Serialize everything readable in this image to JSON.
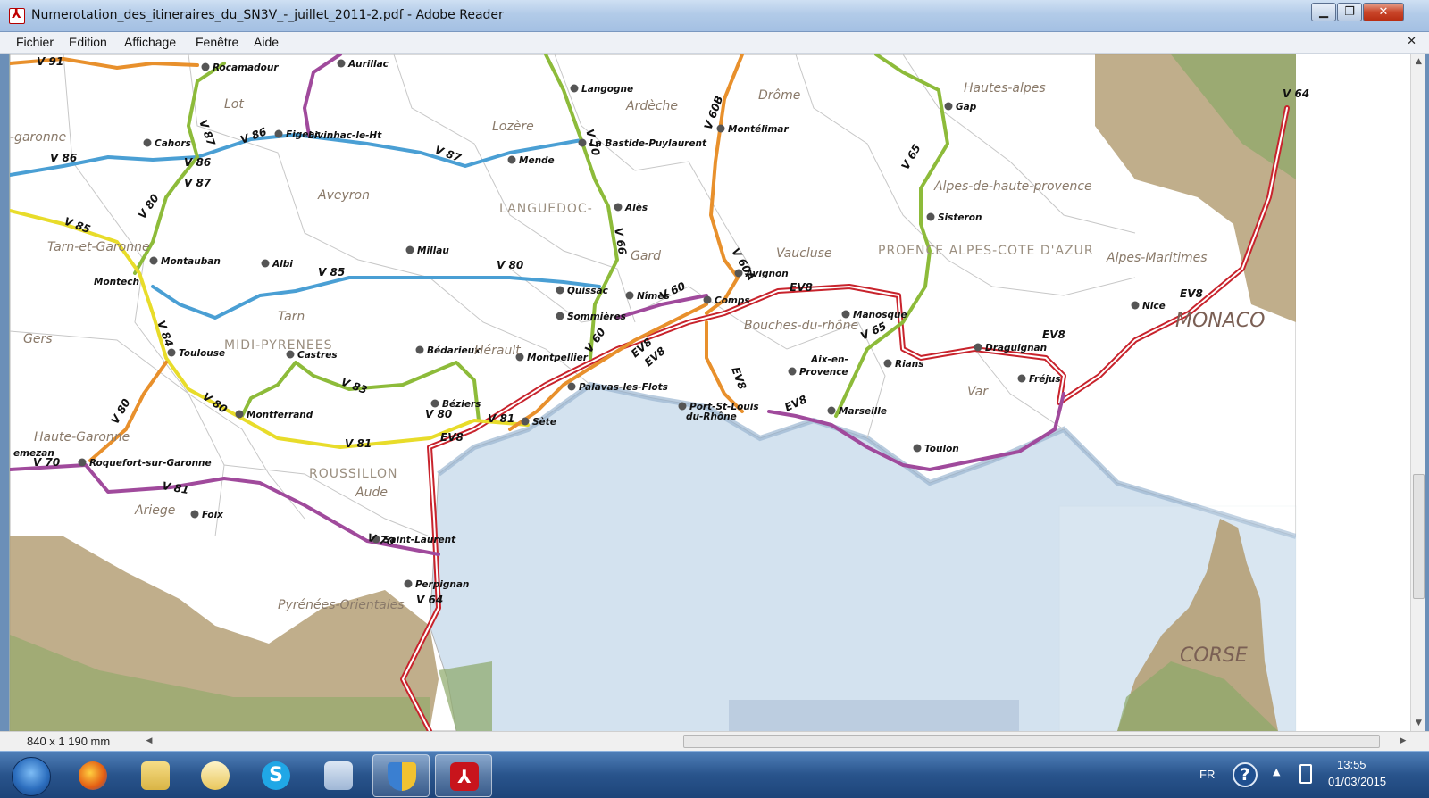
{
  "window": {
    "title": "Numerotation_des_itineraires_du_SN3V_-_juillet_2011-2.pdf - Adobe Reader"
  },
  "menu": [
    "Fichier",
    "Edition",
    "Affichage",
    "Fenêtre",
    "Aide"
  ],
  "status": {
    "page_size": "840 x 1 190 mm"
  },
  "taskbar": {
    "lang": "FR",
    "time": "13:55",
    "date": "01/03/2015"
  },
  "icons": {
    "app": "adobe-reader-icon",
    "start": "windows-start-icon",
    "firefox": "firefox-icon",
    "explorer": "folder-icon",
    "outlook": "mail-icon",
    "skype": "skype-icon",
    "photos": "photo-viewer-icon",
    "shield": "security-shield-icon",
    "reader": "adobe-reader-icon"
  },
  "map": {
    "colors": {
      "sea": "#d3e2ef",
      "land": "#ffffff",
      "relief": "#b5a077",
      "v_blue": "#4a9fd4",
      "v_green": "#8dbb3a",
      "v_orange": "#e8902c",
      "v_yellow": "#e8dc2a",
      "v_purple": "#a04a9c",
      "ev8": "#c8232c"
    },
    "route_labels": [
      "V 91",
      "V 87",
      "V 86",
      "V 86",
      "V 86",
      "V 87",
      "V 87",
      "V 80",
      "V 85",
      "V 85",
      "V 80",
      "V 84",
      "V 83",
      "V 80",
      "V 80",
      "V 80",
      "V 81",
      "V 81",
      "V 81",
      "V 70",
      "V 70",
      "V 70",
      "V 66",
      "V 60",
      "V 60",
      "V 60B",
      "V 60A",
      "EV8",
      "EV8",
      "EV8",
      "EV8",
      "EV8",
      "EV8",
      "EV8",
      "V 64",
      "V 64",
      "V 65",
      "V 65",
      "EV8"
    ],
    "cities": [
      "Rocamadour",
      "Aurillac",
      "Langogne",
      "Cahors",
      "Figeac",
      "Livinhac-le-Ht",
      "Mende",
      "La Bastide-Puylaurent",
      "Montélimar",
      "Gap",
      "Alès",
      "Sisteron",
      "Montauban",
      "Millau",
      "Albi",
      "Quissac",
      "Avignon",
      "Nîmes",
      "Comps",
      "Manosque",
      "Sommières",
      "Montech",
      "Toulouse",
      "Castres",
      "Bédarieux",
      "Montpellier",
      "Palavas-les-Flots",
      "Aix-en-",
      "Provence",
      "Rians",
      "Draguignan",
      "Nice",
      "Fréjus",
      "Béziers",
      "Sète",
      "Port-St-Louis",
      "du-Rhône",
      "Marseille",
      "Montferrand",
      "Toulon",
      "Roquefort-sur-Garonne",
      "emezan",
      "Foix",
      "Saint-Laurent",
      "Perpignan"
    ],
    "departments": [
      "Lot",
      "Lozère",
      "Ardèche",
      "Drôme",
      "Hautes-alpes",
      "-garonne",
      "Aveyron",
      "Alpes-de-haute-provence",
      "Tarn-et-Garonne",
      "Gard",
      "Vaucluse",
      "Alpes-Maritimes",
      "Tarn",
      "Hérault",
      "Bouches-du-rhône",
      "Gers",
      "Var",
      "Haute-Garonne",
      "Aude",
      "Ariege",
      "Pyrénées-Orientales"
    ],
    "regions": [
      "LANGUEDOC-",
      "MIDI-PYRENEES",
      "PROENCE ALPES-COTE D'AZUR",
      "ROUSSILLON"
    ],
    "big": [
      "MONACO",
      "CORSE"
    ]
  }
}
